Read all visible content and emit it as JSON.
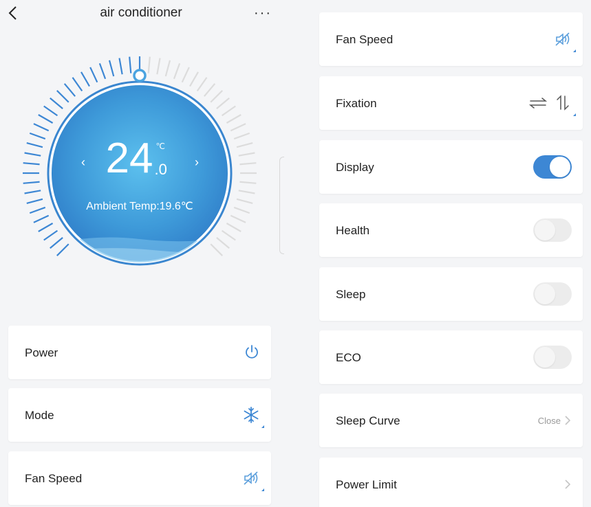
{
  "header": {
    "title": "air conditioner",
    "more": "···"
  },
  "dial": {
    "temperature_int": "24",
    "temperature_unit": "℃",
    "temperature_decimal": ".0",
    "ambient": "Ambient Temp:19.6℃",
    "arrow_left": "‹",
    "arrow_right": "›"
  },
  "left_cards": [
    {
      "label": "Power",
      "icon": "power-icon"
    },
    {
      "label": "Mode",
      "icon": "snowflake-icon"
    },
    {
      "label": "Fan Speed",
      "icon": "fan-mute-icon"
    }
  ],
  "right_cards": [
    {
      "label": "Fan Speed",
      "icon": "fan-mute-icon"
    },
    {
      "label": "Fixation",
      "icon": "swing-arrows-icon"
    },
    {
      "label": "Display",
      "toggle": true
    },
    {
      "label": "Health",
      "toggle": false
    },
    {
      "label": "Sleep",
      "toggle": false
    },
    {
      "label": "ECO",
      "toggle": false
    },
    {
      "label": "Sleep Curve",
      "value": "Close"
    },
    {
      "label": "Power Limit"
    }
  ],
  "colors": {
    "accent": "#3d87d4",
    "dial_center": "#4aa8e2",
    "dial_edge": "#2f7cc8"
  }
}
